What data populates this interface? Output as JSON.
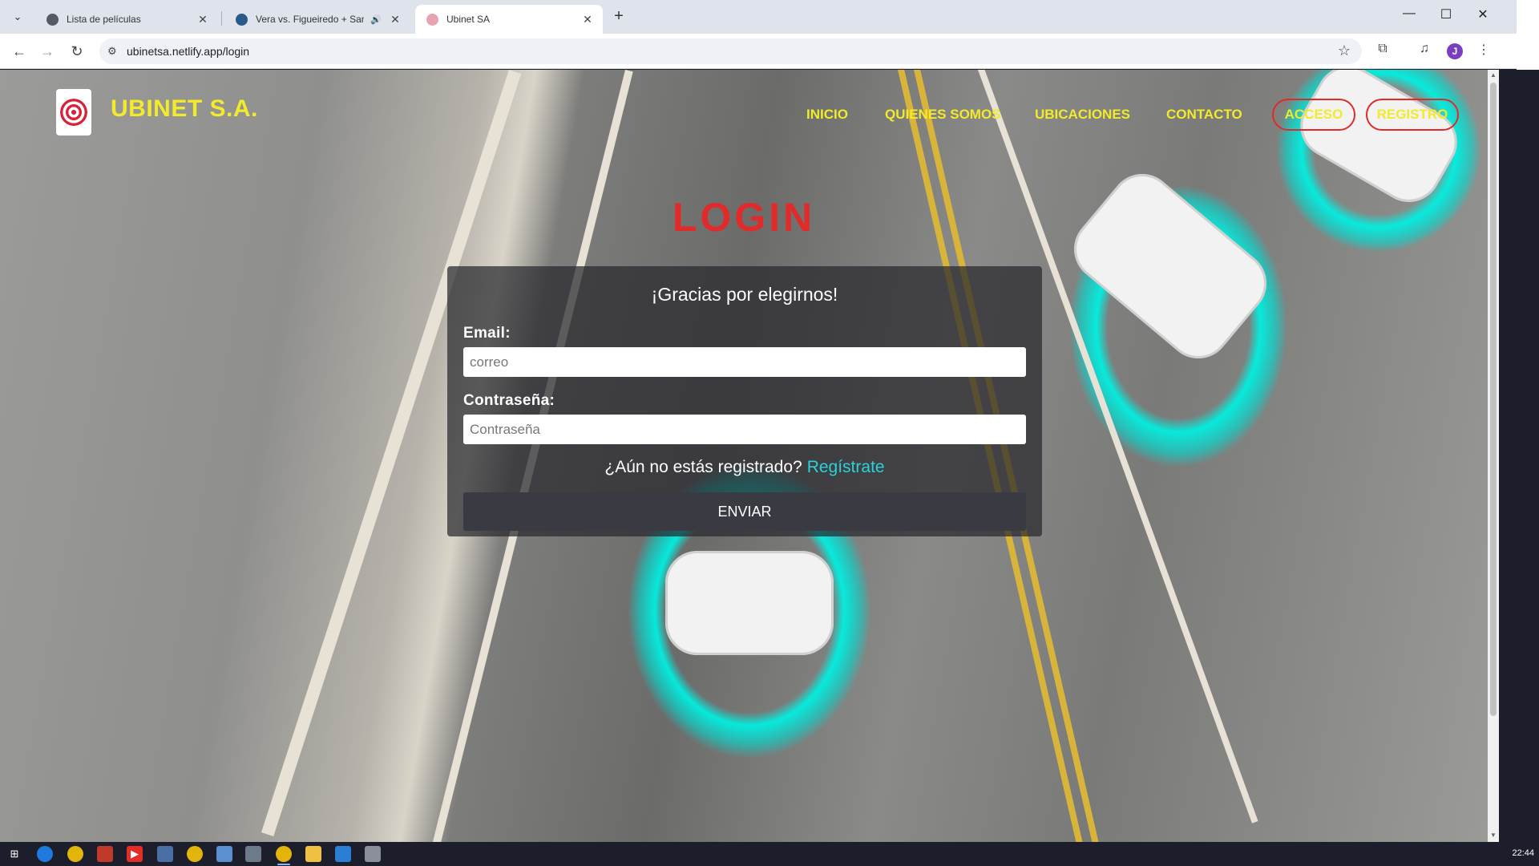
{
  "browser": {
    "tabs": [
      {
        "label": "Lista de películas",
        "favicon_color": "#555a63"
      },
      {
        "label": "Vera vs. Figueiredo + Sandh",
        "favicon_color": "#2a5a8a"
      },
      {
        "label": "Ubinet SA",
        "favicon_color": "#e7a3b1"
      }
    ],
    "new_tab": "+",
    "url": "ubinetsa.netlify.app/login",
    "profile_initial": "J"
  },
  "site": {
    "brand": "UBINET S.A.",
    "nav": {
      "inicio": "INICIO",
      "quienes": "QUIENES SOMOS",
      "ubicaciones": "UBICACIONES",
      "contacto": "CONTACTO",
      "acceso": "ACCESO",
      "registro": "REGISTRO"
    },
    "colors": {
      "brand_yellow": "#f2ea2a",
      "title_red": "#e12b2b",
      "link_cyan": "#2ad2da"
    }
  },
  "login": {
    "title": "LOGIN",
    "greeting": "¡Gracias por elegirnos!",
    "email_label": "Email:",
    "email_placeholder": "correo",
    "password_label": "Contraseña:",
    "password_placeholder": "Contraseña",
    "register_prompt": "¿Aún no estás registrado?",
    "register_link": "Regístrate",
    "submit": "ENVIAR"
  },
  "taskbar": {
    "clock": "22:44"
  }
}
